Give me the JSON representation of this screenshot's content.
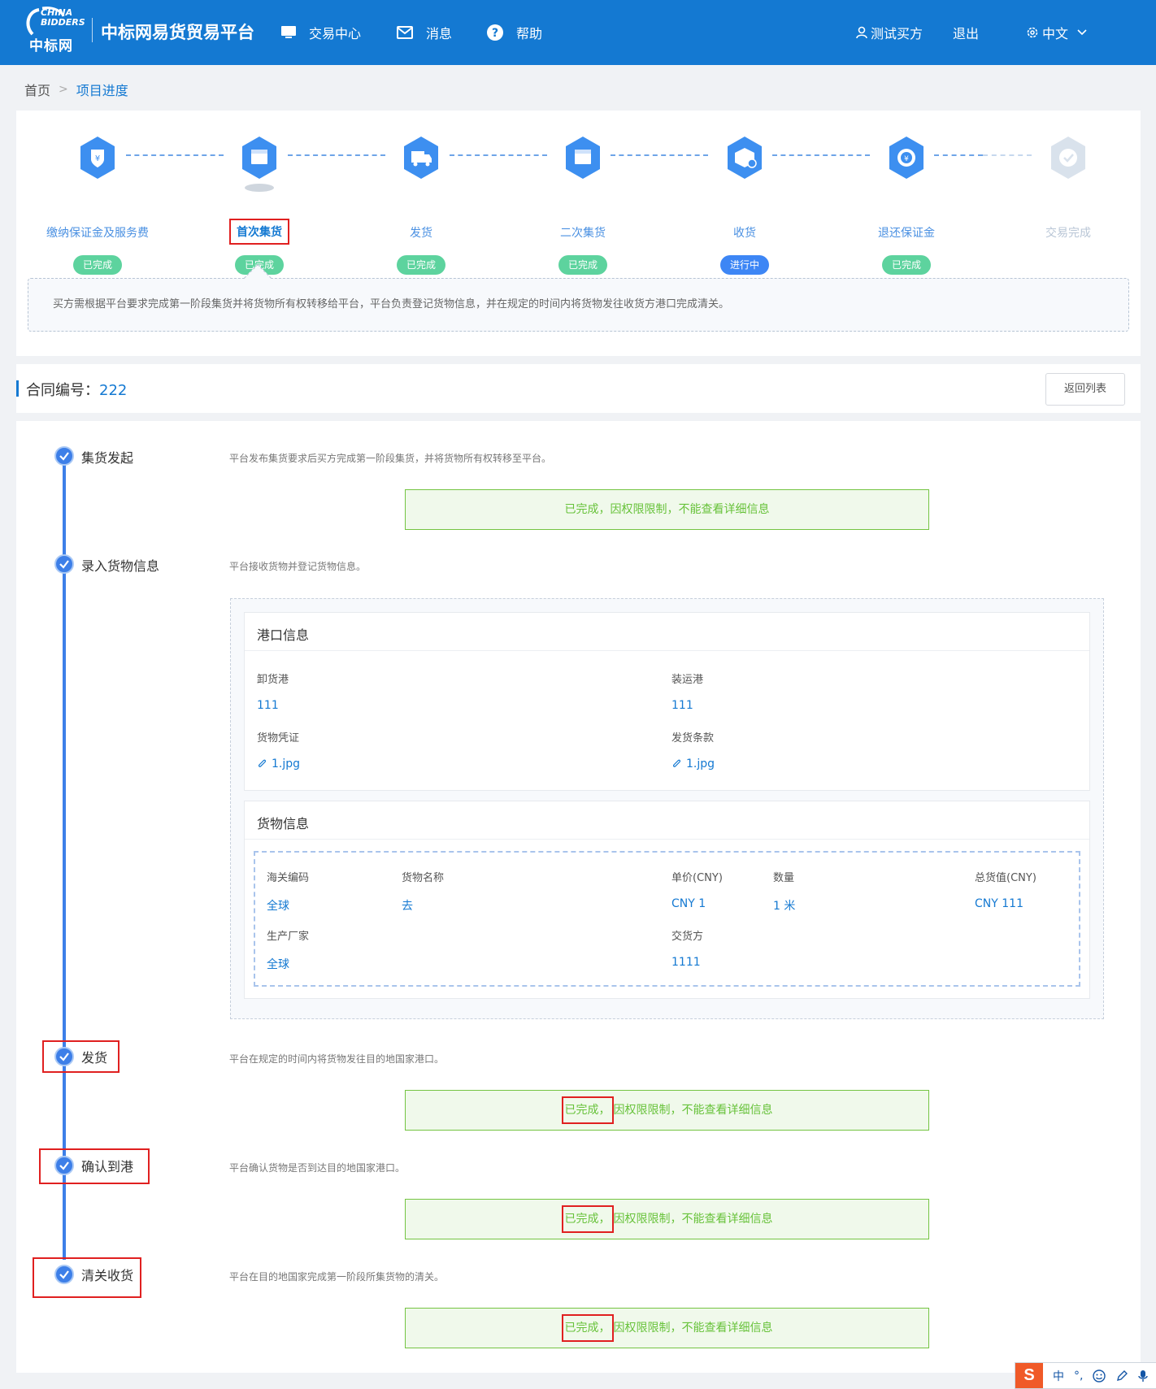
{
  "header": {
    "logo_en_line1": "CHINA",
    "logo_en_line2": "BIDDERS",
    "logo_cn": "中标网",
    "site_title": "中标网易货贸易平台",
    "nav": [
      {
        "label": "交易中心",
        "icon": "monitor-icon"
      },
      {
        "label": "消息",
        "icon": "mail-icon"
      },
      {
        "label": "帮助",
        "icon": "help-icon"
      }
    ],
    "user": "测试买方",
    "logout": "退出",
    "language": "中文"
  },
  "breadcrumb": {
    "home": "首页",
    "current": "项目进度"
  },
  "steps": [
    {
      "label": "缴纳保证金及服务费",
      "status": "已完成",
      "icon": "shield-yuan-icon"
    },
    {
      "label": "首次集货",
      "status": "已完成",
      "icon": "box-icon"
    },
    {
      "label": "发货",
      "status": "已完成",
      "icon": "truck-icon"
    },
    {
      "label": "二次集货",
      "status": "已完成",
      "icon": "box-icon"
    },
    {
      "label": "收货",
      "status": "进行中",
      "icon": "package-check-icon"
    },
    {
      "label": "退还保证金",
      "status": "已完成",
      "icon": "refund-icon"
    },
    {
      "label": "交易完成",
      "status": "",
      "icon": "check-shield-icon"
    }
  ],
  "step_description": "买方需根据平台要求完成第一阶段集货并将货物所有权转移给平台，平台负责登记货物信息，并在规定的时间内将货物发往收货方港口完成清关。",
  "contract": {
    "label": "合同编号：",
    "number": "222",
    "back_button": "返回列表"
  },
  "timeline": [
    {
      "title": "集货发起",
      "desc": "平台发布集货要求后买方完成第一阶段集货，并将货物所有权转移至平台。",
      "notice_done": "已完成，",
      "notice_rest": "因权限限制，不能查看详细信息"
    },
    {
      "title": "录入货物信息",
      "desc": "平台接收货物并登记货物信息。"
    },
    {
      "title": "发货",
      "desc": "平台在规定的时间内将货物发往目的地国家港口。",
      "notice_done": "已完成，",
      "notice_rest": "因权限限制，不能查看详细信息"
    },
    {
      "title": "确认到港",
      "desc": "平台确认货物是否到达目的地国家港口。",
      "notice_done": "已完成，",
      "notice_rest": "因权限限制，不能查看详细信息"
    },
    {
      "title": "清关收货",
      "desc": "平台在目的地国家完成第一阶段所集货物的清关。",
      "notice_done": "已完成，",
      "notice_rest": "因权限限制，不能查看详细信息"
    }
  ],
  "port_info": {
    "title": "港口信息",
    "unload_port_label": "卸货港",
    "unload_port": "111",
    "load_port_label": "装运港",
    "load_port": "111",
    "voucher_label": "货物凭证",
    "voucher_file": "1.jpg",
    "terms_label": "发货条款",
    "terms_file": "1.jpg"
  },
  "goods_info": {
    "title": "货物信息",
    "hs_code_label": "海关编码",
    "hs_code": "全球",
    "name_label": "货物名称",
    "name": "去",
    "unit_price_label": "单价(CNY)",
    "unit_price": "CNY 1",
    "qty_label": "数量",
    "qty": "1 米",
    "total_label": "总货值(CNY)",
    "total": "CNY 111",
    "manufacturer_label": "生产厂家",
    "manufacturer": "全球",
    "deliverer_label": "交货方",
    "deliverer": "1111"
  },
  "ime": {
    "logo": "S",
    "lang": "中",
    "punct": "°,"
  }
}
